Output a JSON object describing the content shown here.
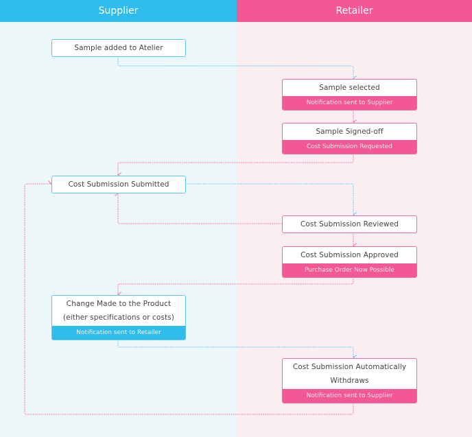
{
  "lanes": {
    "supplier": {
      "label": "Supplier",
      "color": "#30bcea"
    },
    "retailer": {
      "label": "Retailer",
      "color": "#f25894"
    }
  },
  "steps": {
    "sample_added": {
      "title": "Sample added to Atelier"
    },
    "sample_selected": {
      "title": "Sample selected",
      "note": "Notification sent to Supplier"
    },
    "sample_signed_off": {
      "title": "Sample Signed-off",
      "note": "Cost Submission Requested"
    },
    "cost_submitted": {
      "title": "Cost Submission Submitted"
    },
    "cost_reviewed": {
      "title": "Cost Submission Reviewed"
    },
    "cost_approved": {
      "title": "Cost Submission Approved",
      "note": "Purchase Order Now Possible"
    },
    "change_made": {
      "title": "Change Made to the Product",
      "subtitle": "(either specifications or costs)",
      "note": "Notification sent to Retailer"
    },
    "auto_withdraw": {
      "title_line1": "Cost Submission Automatically",
      "title_line2": "Withdraws",
      "note": "Notification sent to Supplier"
    }
  }
}
